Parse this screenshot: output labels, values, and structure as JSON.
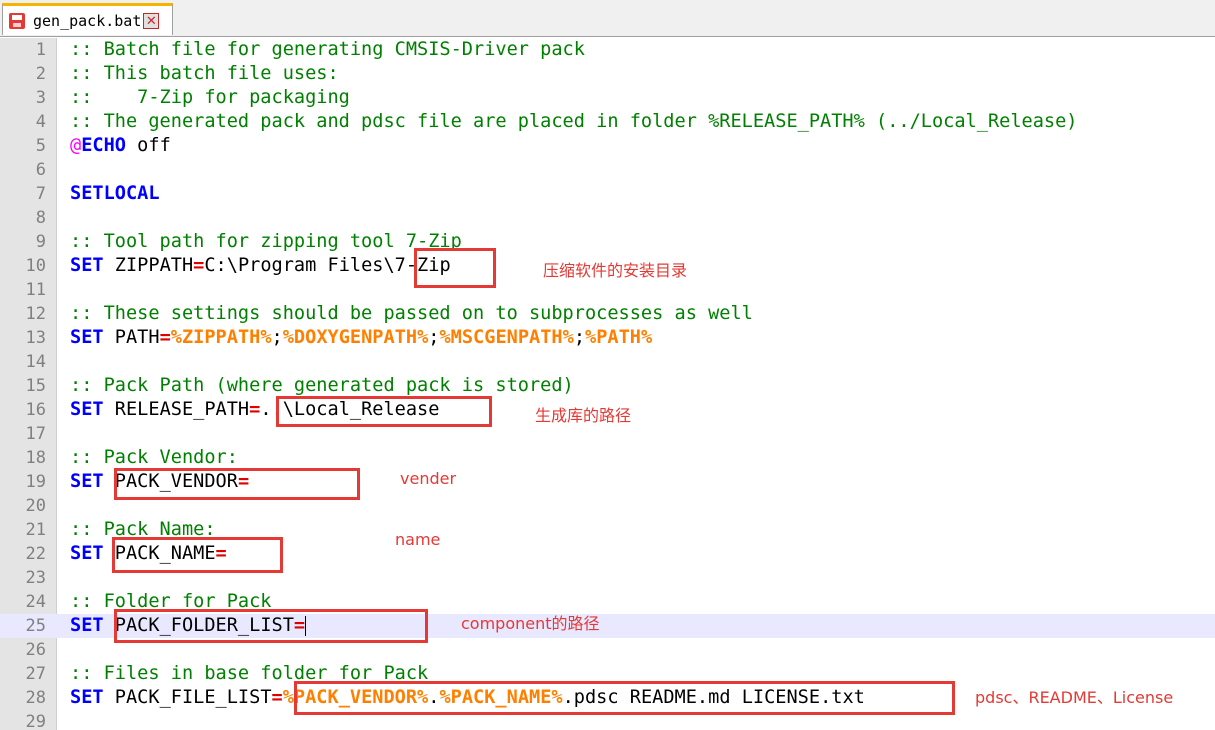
{
  "tab": {
    "filename": "gen_pack.bat",
    "close_glyph": "✕"
  },
  "lines": [
    {
      "n": "1",
      "t": [
        [
          ":: Batch file for generating CMSIS-Driver pack",
          "cmt"
        ]
      ]
    },
    {
      "n": "2",
      "t": [
        [
          ":: This batch file uses:",
          "cmt"
        ]
      ]
    },
    {
      "n": "3",
      "t": [
        [
          "::    7-Zip for packaging",
          "cmt"
        ]
      ]
    },
    {
      "n": "4",
      "t": [
        [
          ":: The generated pack and pdsc file are placed in folder %RELEASE_PATH% (../Local_Release)",
          "cmt"
        ]
      ]
    },
    {
      "n": "5",
      "t": [
        [
          "@",
          "echo"
        ],
        [
          "ECHO",
          "kw"
        ],
        [
          " off",
          "txt"
        ]
      ]
    },
    {
      "n": "6",
      "t": []
    },
    {
      "n": "7",
      "t": [
        [
          "SETLOCAL",
          "kw"
        ]
      ]
    },
    {
      "n": "8",
      "t": []
    },
    {
      "n": "9",
      "t": [
        [
          ":: Tool path for zipping tool 7-Zip",
          "cmt"
        ]
      ]
    },
    {
      "n": "10",
      "t": [
        [
          "SET",
          "kw"
        ],
        [
          " ZIPPATH",
          "txt"
        ],
        [
          "=",
          "op"
        ],
        [
          "C:\\Program Files\\7-Zip",
          "txt"
        ]
      ]
    },
    {
      "n": "11",
      "t": []
    },
    {
      "n": "12",
      "t": [
        [
          ":: These settings should be passed on to subprocesses as well",
          "cmt"
        ]
      ]
    },
    {
      "n": "13",
      "t": [
        [
          "SET",
          "kw"
        ],
        [
          " PATH",
          "txt"
        ],
        [
          "=",
          "op"
        ],
        [
          "%ZIPPATH%",
          "var"
        ],
        [
          ";",
          "txt"
        ],
        [
          "%DOXYGENPATH%",
          "var"
        ],
        [
          ";",
          "txt"
        ],
        [
          "%MSCGENPATH%",
          "var"
        ],
        [
          ";",
          "txt"
        ],
        [
          "%PATH%",
          "var"
        ]
      ]
    },
    {
      "n": "14",
      "t": []
    },
    {
      "n": "15",
      "t": [
        [
          ":: Pack Path (where generated pack is stored)",
          "cmt"
        ]
      ]
    },
    {
      "n": "16",
      "t": [
        [
          "SET",
          "kw"
        ],
        [
          " RELEASE_PATH",
          "txt"
        ],
        [
          "=",
          "op"
        ],
        [
          "..\\Local_Release",
          "txt"
        ]
      ]
    },
    {
      "n": "17",
      "t": []
    },
    {
      "n": "18",
      "t": [
        [
          ":: Pack Vendor:",
          "cmt"
        ]
      ]
    },
    {
      "n": "19",
      "t": [
        [
          "SET",
          "kw"
        ],
        [
          " PACK_VENDOR",
          "txt"
        ],
        [
          "=",
          "op"
        ]
      ]
    },
    {
      "n": "20",
      "t": []
    },
    {
      "n": "21",
      "t": [
        [
          ":: Pack Name:",
          "cmt"
        ]
      ]
    },
    {
      "n": "22",
      "t": [
        [
          "SET",
          "kw"
        ],
        [
          " PACK_NAME",
          "txt"
        ],
        [
          "=",
          "op"
        ]
      ]
    },
    {
      "n": "23",
      "t": []
    },
    {
      "n": "24",
      "t": [
        [
          ":: Folder for Pack",
          "cmt"
        ]
      ]
    },
    {
      "n": "25",
      "t": [
        [
          "SET",
          "kw"
        ],
        [
          " PACK_FOLDER_LIST",
          "txt"
        ],
        [
          "=",
          "op"
        ]
      ],
      "current": true
    },
    {
      "n": "26",
      "t": []
    },
    {
      "n": "27",
      "t": [
        [
          ":: Files in base folder for Pack",
          "cmt"
        ]
      ]
    },
    {
      "n": "28",
      "t": [
        [
          "SET",
          "kw"
        ],
        [
          " PACK_FILE_LIST",
          "txt"
        ],
        [
          "=",
          "op"
        ],
        [
          "%PACK_VENDOR%",
          "var"
        ],
        [
          ".",
          "txt"
        ],
        [
          "%PACK_NAME%",
          "var"
        ],
        [
          ".pdsc README.md LICENSE.txt",
          "txt"
        ]
      ]
    },
    {
      "n": "29",
      "t": []
    }
  ],
  "annotations": {
    "zip_note": "压缩软件的安装目录",
    "release_note": "生成库的路径",
    "vendor_note": "vender",
    "name_note": "name",
    "folder_note": "component的路径",
    "files_note": "pdsc、README、License"
  },
  "colors": {
    "comment": "#008000",
    "keyword": "#0000ff",
    "operator": "#e00000",
    "variable": "#ff8000",
    "annotation": "#e53935",
    "current_line": "#e8e8ff"
  }
}
